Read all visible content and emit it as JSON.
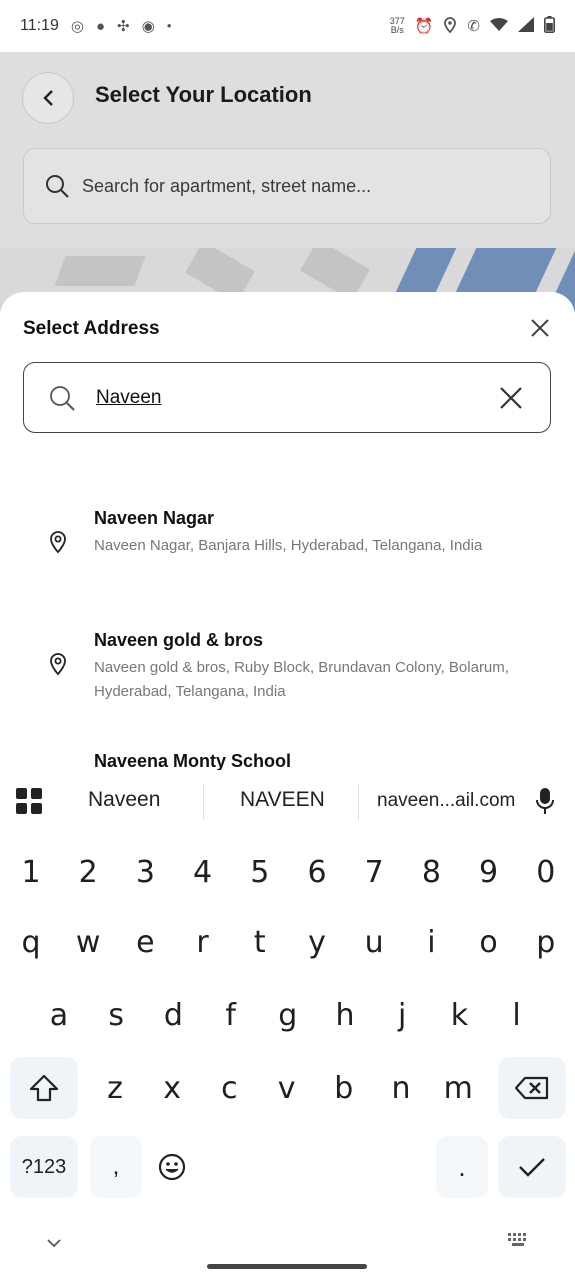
{
  "status_bar": {
    "time": "11:19",
    "net_speed_value": "377",
    "net_speed_unit": "B/s",
    "left_icons": [
      "camera-icon",
      "chat-icon",
      "fan-icon",
      "message-icon",
      "dot-icon"
    ],
    "right_icons": [
      "alarm-icon",
      "location-icon",
      "call-icon",
      "wifi-icon",
      "signal-icon",
      "battery-icon"
    ]
  },
  "background_page": {
    "title": "Select Your Location",
    "search_placeholder": "Search for apartment, street name..."
  },
  "sheet": {
    "title": "Select Address",
    "search_value": "Naveen",
    "results": [
      {
        "title": "Naveen Nagar",
        "subtitle": "Naveen Nagar, Banjara Hills, Hyderabad, Telangana, India"
      },
      {
        "title": "Naveen gold & bros",
        "subtitle": "Naveen gold & bros, Ruby Block, Brundavan Colony, Bolarum, Hyderabad, Telangana, India"
      },
      {
        "title": "Naveena Monty School",
        "subtitle": ""
      }
    ]
  },
  "keyboard": {
    "suggestions": [
      "Naveen",
      "NAVEEN",
      "naveen...ail.com"
    ],
    "row_numbers": [
      "1",
      "2",
      "3",
      "4",
      "5",
      "6",
      "7",
      "8",
      "9",
      "0"
    ],
    "row_1": [
      "q",
      "w",
      "e",
      "r",
      "t",
      "y",
      "u",
      "i",
      "o",
      "p"
    ],
    "row_2": [
      "a",
      "s",
      "d",
      "f",
      "g",
      "h",
      "j",
      "k",
      "l"
    ],
    "row_3": [
      "z",
      "x",
      "c",
      "v",
      "b",
      "n",
      "m"
    ],
    "symbols_key": "?123",
    "comma_key": ",",
    "period_key": "."
  }
}
